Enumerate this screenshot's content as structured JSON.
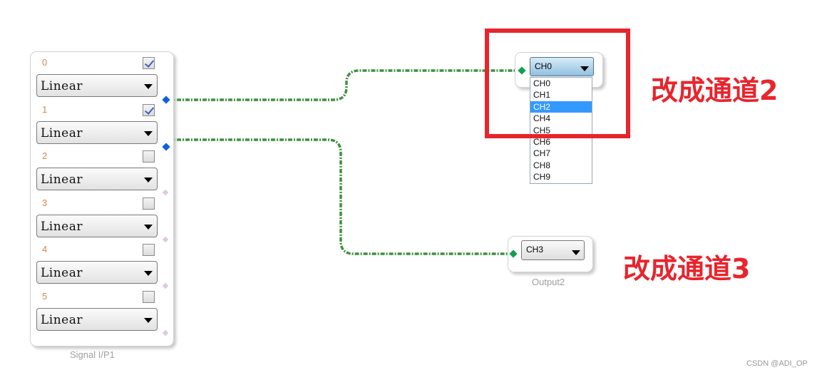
{
  "signal_block": {
    "caption": "Signal I/P1",
    "channels": [
      {
        "label": "0",
        "checked": true,
        "mode": "Linear",
        "connected": true
      },
      {
        "label": "1",
        "checked": true,
        "mode": "Linear",
        "connected": true
      },
      {
        "label": "2",
        "checked": false,
        "mode": "Linear",
        "connected": false
      },
      {
        "label": "3",
        "checked": false,
        "mode": "Linear",
        "connected": false
      },
      {
        "label": "4",
        "checked": false,
        "mode": "Linear",
        "connected": false
      },
      {
        "label": "5",
        "checked": false,
        "mode": "Linear",
        "connected": false
      }
    ]
  },
  "output1": {
    "selected": "CH0",
    "options": [
      "CH0",
      "CH1",
      "CH2",
      "CH4",
      "CH5",
      "CH6",
      "CH7",
      "CH8",
      "CH9"
    ],
    "highlighted": "CH2"
  },
  "output2": {
    "caption": "Output2",
    "selected": "CH3"
  },
  "annotations": {
    "note1": "改成通道2",
    "note2": "改成通道3"
  },
  "watermark": "CSDN @ADI_OP",
  "colors": {
    "annotation": "#e8242c",
    "wire": "#3f8f3f",
    "connected_port": "#1060e0",
    "output_port": "#10a050",
    "highlight": "#3399ff"
  }
}
